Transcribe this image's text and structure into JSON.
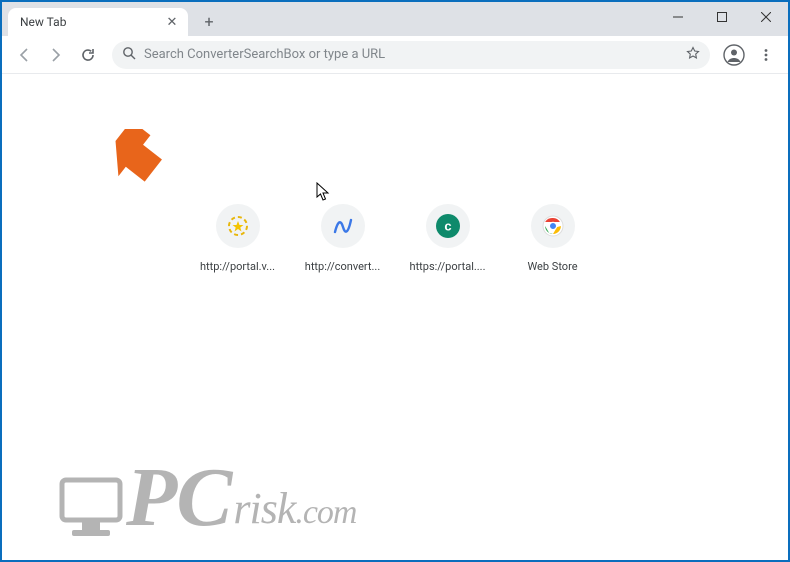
{
  "window": {
    "tab_title": "New Tab"
  },
  "toolbar": {
    "omnibox_placeholder": "Search ConverterSearchBox or type a URL"
  },
  "shortcuts": [
    {
      "label": "http://portal.v..."
    },
    {
      "label": "http://convert..."
    },
    {
      "label": "https://portal...."
    },
    {
      "label": "Web Store"
    }
  ],
  "watermark": {
    "pc": "PC",
    "risk": "risk",
    "com": ".com"
  }
}
